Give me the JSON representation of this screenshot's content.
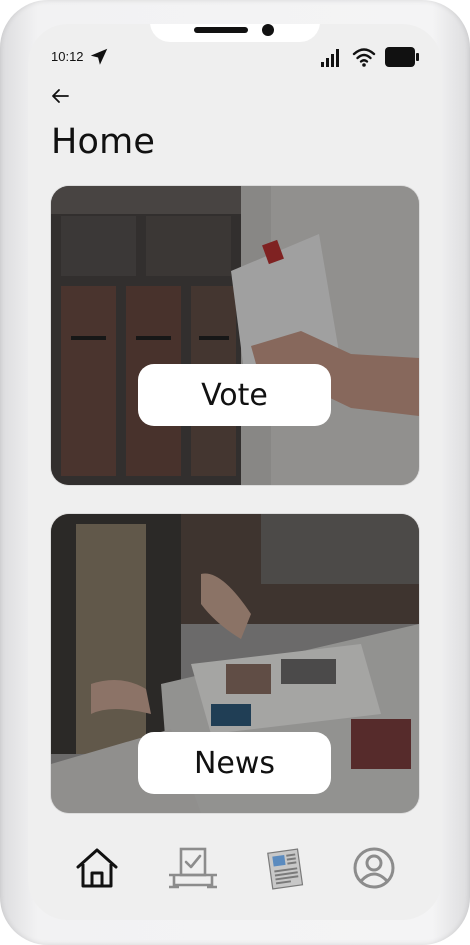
{
  "status_bar": {
    "time": "10:12",
    "icons": [
      "location-arrow-icon",
      "cellular-signal-icon",
      "wifi-icon",
      "battery-icon"
    ]
  },
  "header": {
    "back_icon": "back-arrow-icon",
    "title": "Home"
  },
  "cards": [
    {
      "id": "vote",
      "label": "Vote",
      "image": "photo of hand posting ballot envelope into mailbox"
    },
    {
      "id": "news",
      "label": "News",
      "image": "photo of people reading newspapers on a table"
    }
  ],
  "tab_bar": {
    "items": [
      {
        "id": "home",
        "icon": "home-icon",
        "active": true
      },
      {
        "id": "vote",
        "icon": "ballot-box-icon",
        "active": false
      },
      {
        "id": "news",
        "icon": "newspaper-icon",
        "active": false
      },
      {
        "id": "profile",
        "icon": "user-profile-icon",
        "active": false
      }
    ]
  },
  "colors": {
    "screen_bg": "#efefef",
    "text": "#111111",
    "inactive_icon": "#8c8c8c",
    "label_bg": "#ffffff"
  }
}
